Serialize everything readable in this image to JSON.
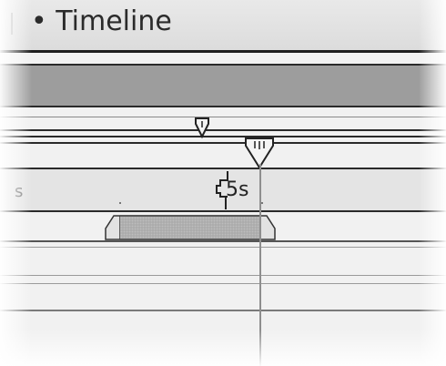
{
  "panel": {
    "title": "Timeline",
    "title_bullet": "•"
  },
  "ruler": {
    "left_label": "s",
    "time_marker_label": "5s"
  },
  "icons": {
    "work_area_start_marker": "work-area-start-icon",
    "current_time_indicator": "current-time-indicator-icon",
    "layer_in_handle": "layer-in-handle-icon",
    "layer_out_handle": "layer-out-handle-icon"
  },
  "colors": {
    "header_band": "#9d9d9d",
    "layer_bar": "#a8a8a8",
    "panel_bg": "#f1f1f1"
  }
}
